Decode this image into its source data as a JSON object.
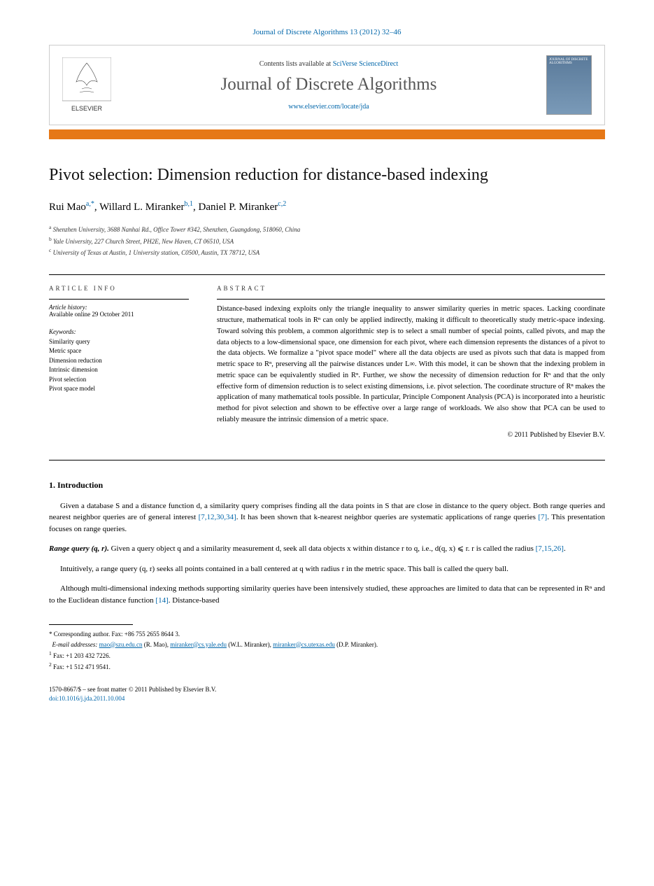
{
  "journal_header": "Journal of Discrete Algorithms 13 (2012) 32–46",
  "banner": {
    "contents_prefix": "Contents lists available at ",
    "contents_link": "SciVerse ScienceDirect",
    "journal_name": "Journal of Discrete Algorithms",
    "journal_url": "www.elsevier.com/locate/jda",
    "cover_title": "JOURNAL OF DISCRETE ALGORITHMS"
  },
  "title": "Pivot selection: Dimension reduction for distance-based indexing",
  "authors": [
    {
      "name": "Rui Mao",
      "marks": "a,*"
    },
    {
      "name": "Willard L. Miranker",
      "marks": "b,1"
    },
    {
      "name": "Daniel P. Miranker",
      "marks": "c,2"
    }
  ],
  "affiliations": [
    {
      "mark": "a",
      "text": "Shenzhen University, 3688 Nanhai Rd., Office Tower #342, Shenzhen, Guangdong, 518060, China"
    },
    {
      "mark": "b",
      "text": "Yale University, 227 Church Street, PH2E, New Haven, CT 06510, USA"
    },
    {
      "mark": "c",
      "text": "University of Texas at Austin, 1 University station, C0500, Austin, TX 78712, USA"
    }
  ],
  "article_info": {
    "label": "article info",
    "history_label": "Article history:",
    "history": "Available online 29 October 2011",
    "keywords_label": "Keywords:",
    "keywords": [
      "Similarity query",
      "Metric space",
      "Dimension reduction",
      "Intrinsic dimension",
      "Pivot selection",
      "Pivot space model"
    ]
  },
  "abstract": {
    "label": "abstract",
    "text": "Distance-based indexing exploits only the triangle inequality to answer similarity queries in metric spaces. Lacking coordinate structure, mathematical tools in Rⁿ can only be applied indirectly, making it difficult to theoretically study metric-space indexing. Toward solving this problem, a common algorithmic step is to select a small number of special points, called pivots, and map the data objects to a low-dimensional space, one dimension for each pivot, where each dimension represents the distances of a pivot to the data objects. We formalize a \"pivot space model\" where all the data objects are used as pivots such that data is mapped from metric space to Rⁿ, preserving all the pairwise distances under L∞. With this model, it can be shown that the indexing problem in metric space can be equivalently studied in Rⁿ. Further, we show the necessity of dimension reduction for Rⁿ and that the only effective form of dimension reduction is to select existing dimensions, i.e. pivot selection. The coordinate structure of Rⁿ makes the application of many mathematical tools possible. In particular, Principle Component Analysis (PCA) is incorporated into a heuristic method for pivot selection and shown to be effective over a large range of workloads. We also show that PCA can be used to reliably measure the intrinsic dimension of a metric space.",
    "copyright": "© 2011 Published by Elsevier B.V."
  },
  "section1": {
    "heading": "1. Introduction",
    "p1_a": "Given a database S and a distance function d, a similarity query comprises finding all the data points in S that are close in distance to the query object. Both range queries and nearest neighbor queries are of general interest ",
    "p1_ref1": "[7,12,30,34]",
    "p1_b": ". It has been shown that k-nearest neighbor queries are systematic applications of range queries ",
    "p1_ref2": "[7]",
    "p1_c": ". This presentation focuses on range queries.",
    "range_label": "Range query (q, r).",
    "range_text_a": " Given a query object q and a similarity measurement d, seek all data objects x within distance r to q, i.e., d(q, x) ⩽ r. r is called the radius ",
    "range_ref": "[7,15,26]",
    "range_text_b": ".",
    "p2": "Intuitively, a range query (q, r) seeks all points contained in a ball centered at q with radius r in the metric space. This ball is called the query ball.",
    "p3_a": "Although multi-dimensional indexing methods supporting similarity queries have been intensively studied, these approaches are limited to data that can be represented in Rⁿ and to the Euclidean distance function ",
    "p3_ref": "[14]",
    "p3_b": ". Distance-based"
  },
  "footnotes": {
    "corresponding": "Corresponding author. Fax: +86 755 2655 8644 3.",
    "emails_label": "E-mail addresses:",
    "emails": [
      {
        "addr": "mao@szu.edu.cn",
        "who": "(R. Mao)"
      },
      {
        "addr": "miranker@cs.yale.edu",
        "who": "(W.L. Miranker)"
      },
      {
        "addr": "miranker@cs.utexas.edu",
        "who": "(D.P. Miranker)"
      }
    ],
    "fn1": "Fax: +1 203 432 7226.",
    "fn2": "Fax: +1 512 471 9541."
  },
  "bottom": {
    "issn": "1570-8667/$ – see front matter © 2011 Published by Elsevier B.V.",
    "doi": "doi:10.1016/j.jda.2011.10.004"
  }
}
